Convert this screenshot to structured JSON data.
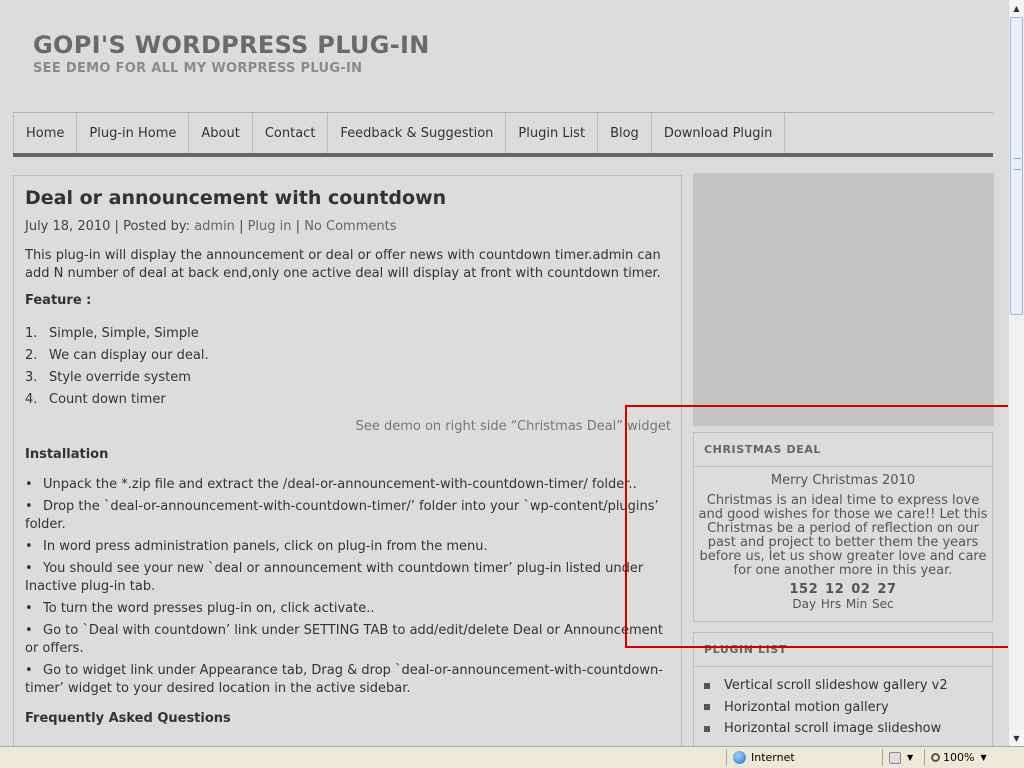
{
  "header": {
    "site_title": "GOPI'S WORDPRESS PLUG-IN",
    "tagline": "SEE DEMO FOR ALL MY WORPRESS PLUG-IN"
  },
  "nav": {
    "items": [
      {
        "label": "Home"
      },
      {
        "label": "Plug-in Home"
      },
      {
        "label": "About"
      },
      {
        "label": "Contact"
      },
      {
        "label": "Feedback & Suggestion"
      },
      {
        "label": "Plugin List"
      },
      {
        "label": "Blog"
      },
      {
        "label": "Download Plugin"
      }
    ]
  },
  "post": {
    "title": "Deal or announcement with countdown",
    "meta": {
      "date": "July 18, 2010",
      "posted_by_label": "Posted by:",
      "author": "admin",
      "category": "Plug in",
      "comments": "No Comments",
      "sep": "|"
    },
    "intro": "This plug-in will display the announcement or deal or offer news with countdown timer.admin can add N number of deal at back end,only one active deal will display at front with countdown timer.",
    "feature_heading": "Feature :",
    "features": [
      {
        "num": "1.",
        "text": "Simple, Simple, Simple"
      },
      {
        "num": "2.",
        "text": "We can display our deal."
      },
      {
        "num": "3.",
        "text": "Style override system"
      },
      {
        "num": "4.",
        "text": "Count down timer"
      }
    ],
    "demo_note": "See demo on right side “Christmas Deal” widget",
    "installation_heading": "Installation",
    "installation": [
      "Unpack the *.zip file and extract the /deal-or-announcement-with-countdown-timer/ folder..",
      "Drop the `deal-or-announcement-with-countdown-timer/’ folder into your `wp-content/plugins’ folder.",
      "In word press administration panels, click on plug-in from the menu.",
      "You should see your new `deal or announcement with countdown timer’ plug-in listed under Inactive plug-in tab.",
      "To turn the word presses plug-in on, click activate..",
      "Go to `Deal with countdown’ link under SETTING TAB to add/edit/delete Deal or Announcement or offers.",
      "Go to widget link under Appearance tab, Drag & drop `deal-or-announcement-with-countdown-timer’ widget to your desired location in the active sidebar."
    ],
    "faq_heading": "Frequently Asked Questions",
    "bullet": "•"
  },
  "sidebar": {
    "christmas_deal": {
      "title": "CHRISTMAS DEAL",
      "heading": "Merry Christmas 2010",
      "text": "Christmas is an ideal time to express love and good wishes for those we care!! Let this Christmas be a period of reflection on our past and project to better them the years before us, let us show greater love and care for one another more in this year.",
      "countdown": {
        "day": "152",
        "hrs": "12",
        "min": "02",
        "sec": "27"
      },
      "labels": {
        "day": "Day",
        "hrs": "Hrs",
        "min": "Min",
        "sec": "Sec"
      }
    },
    "plugin_list": {
      "title": "PLUGIN LIST",
      "items": [
        "Vertical scroll slideshow gallery v2",
        "Horizontal motion gallery",
        "Horizontal scroll image slideshow"
      ]
    }
  },
  "statusbar": {
    "zone": "Internet",
    "zoom": "100%"
  },
  "colors": {
    "highlight": "#d40000",
    "page_bg": "#dcdcdc"
  }
}
